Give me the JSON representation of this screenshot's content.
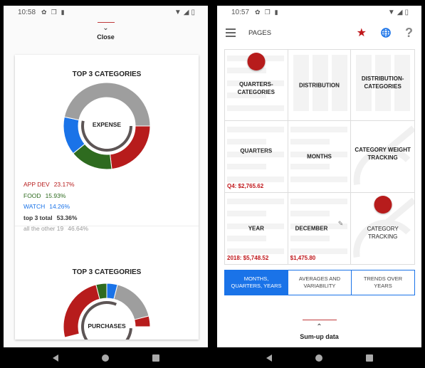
{
  "left": {
    "status": {
      "time": "10:58"
    },
    "close_label": "Close",
    "expense_card": {
      "title": "TOP 3 CATEGORIES",
      "center_label": "EXPENSE",
      "legend": [
        {
          "name": "APP DEV",
          "pct": "23.17%",
          "color": "#b71c1c"
        },
        {
          "name": "FOOD",
          "pct": "15.93%",
          "color": "#2e6b1f"
        },
        {
          "name": "WATCH",
          "pct": "14.26%",
          "color": "#1a73e8"
        },
        {
          "name": "top 3 total",
          "pct": "53.36%",
          "color": "#333333"
        },
        {
          "name": "all the other  19",
          "pct": "46.64%",
          "color": "#999999"
        }
      ]
    },
    "purchases_card": {
      "title": "TOP 3 CATEGORIES",
      "center_label": "PURCHASES"
    }
  },
  "right": {
    "status": {
      "time": "10:57"
    },
    "toolbar": {
      "title": "PAGES",
      "star": "★",
      "help": "?"
    },
    "grid": [
      {
        "label": "QUARTERS-\nCATEGORIES",
        "value": ""
      },
      {
        "label": "DISTRIBUTION",
        "value": ""
      },
      {
        "label": "DISTRIBUTION-\nCATEGORIES",
        "value": ""
      },
      {
        "label": "QUARTERS",
        "value": "Q4: $2,765.62"
      },
      {
        "label": "MONTHS",
        "value": ""
      },
      {
        "label": "CATEGORY WEIGHT\nTRACKING",
        "value": ""
      },
      {
        "label": "YEAR",
        "value": "2018: $5,748.52"
      },
      {
        "label": "DECEMBER",
        "value": "$1,475.80"
      },
      {
        "label": "CATEGORY\nTRACKING",
        "value": ""
      }
    ],
    "tabs": [
      {
        "label": "MONTHS,\nQUARTERS, YEARS",
        "active": true
      },
      {
        "label": "AVERAGES AND\nVARIABILITY",
        "active": false
      },
      {
        "label": "TRENDS OVER\nYEARS",
        "active": false
      }
    ],
    "sumup_label": "Sum-up data"
  },
  "chart_data": [
    {
      "type": "pie",
      "title": "TOP 3 CATEGORIES",
      "center_label": "EXPENSE",
      "categories": [
        "APP DEV",
        "FOOD",
        "WATCH",
        "all the other"
      ],
      "values": [
        23.17,
        15.93,
        14.26,
        46.64
      ],
      "colors": [
        "#b71c1c",
        "#2e6b1f",
        "#1a73e8",
        "#9e9e9e"
      ],
      "inner_ring_total": 53.36
    },
    {
      "type": "pie",
      "title": "TOP 3 CATEGORIES",
      "center_label": "PURCHASES",
      "categories": [
        "red",
        "green",
        "blue",
        "other"
      ],
      "colors": [
        "#b71c1c",
        "#2e6b1f",
        "#1a73e8",
        "#9e9e9e"
      ]
    }
  ]
}
